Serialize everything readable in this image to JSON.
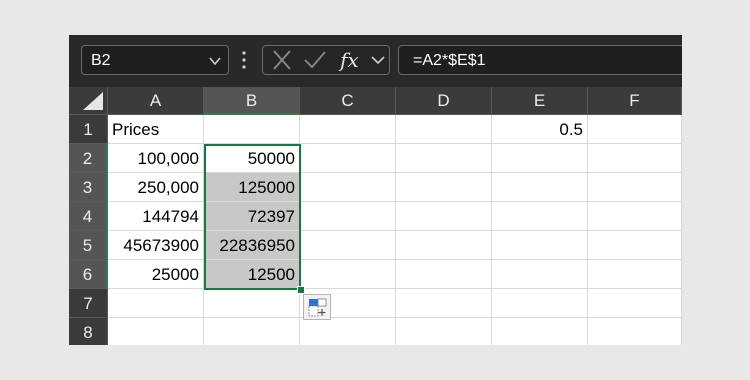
{
  "formula_bar": {
    "name_box": "B2",
    "formula": "=A2*$E$1"
  },
  "icons": {
    "name_box_dropdown": "chevron-down-icon",
    "more": "vertical-dots-icon",
    "cancel": "x-icon",
    "enter": "check-icon",
    "insert_function": "fx-icon",
    "fx_dropdown": "chevron-down-icon",
    "select_all": "triangle-corner-icon",
    "autofill_options": "autofill-options-icon"
  },
  "columns": [
    "A",
    "B",
    "C",
    "D",
    "E",
    "F"
  ],
  "selected_column": "B",
  "rows": [
    "1",
    "2",
    "3",
    "4",
    "5",
    "6",
    "7",
    "8"
  ],
  "cells": {
    "A1": "Prices",
    "E1": "0.5",
    "A2": "100,000",
    "B2": "50000",
    "A3": "250,000",
    "B3": "125000",
    "A4": "144794",
    "B4": "72397",
    "A5": "45673900",
    "B5": "22836950",
    "A6": "25000",
    "B6": "12500"
  },
  "colors": {
    "selection_border": "#217346",
    "header_bg": "#3b3b3b",
    "selected_header_bg": "#555555",
    "selection_fill": "#c8c8c8"
  }
}
